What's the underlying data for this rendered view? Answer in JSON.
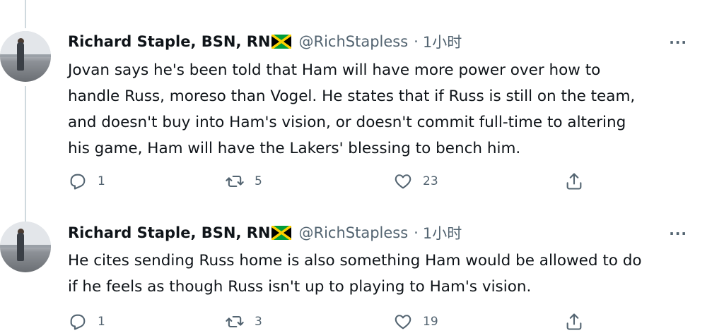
{
  "tweets": [
    {
      "author": "Richard Staple, BSN, RN",
      "handle": "@RichStapless",
      "time": "1小时",
      "more": "···",
      "text_lines": [
        "Jovan says he's been told that Ham will have more power over how to",
        "handle Russ, moreso than Vogel. He states that if Russ is still on the team,",
        "and doesn't buy into Ham's vision, or doesn't commit full-time to altering",
        "his game, Ham will have the Lakers' blessing to bench him."
      ],
      "replies": "1",
      "retweets": "5",
      "likes": "23"
    },
    {
      "author": "Richard Staple, BSN, RN",
      "handle": "@RichStapless",
      "time": "1小时",
      "more": "···",
      "text_lines": [
        "He cites sending Russ home is also something Ham would be allowed to do",
        "if he feels as though Russ isn't up to playing to Ham's vision."
      ],
      "replies": "1",
      "retweets": "3",
      "likes": "19"
    }
  ],
  "icons": {
    "reply": "reply-icon",
    "retweet": "retweet-icon",
    "like": "heart-icon",
    "share": "share-icon",
    "flag": "jamaica-flag-icon"
  },
  "colors": {
    "text": "#0f1419",
    "secondary": "#536471",
    "thread_line": "#cfd9de"
  }
}
